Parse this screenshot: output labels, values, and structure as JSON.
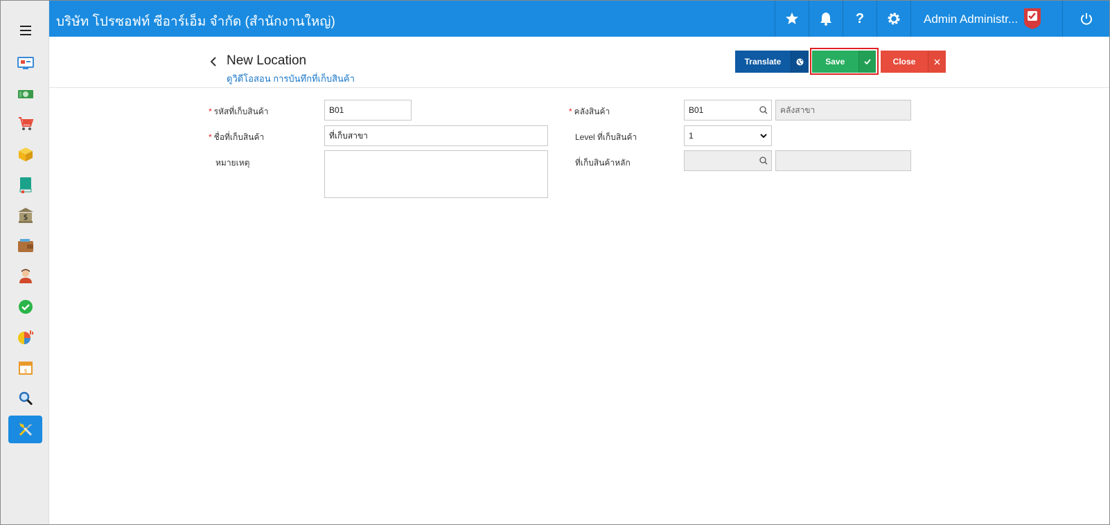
{
  "header": {
    "company": "บริษัท โปรซอฟท์ ซีอาร์เอ็ม จำกัด (สำนักงานใหญ่)",
    "user_name": "Admin Administr...",
    "icons": [
      "star-icon",
      "bell-icon",
      "help-icon",
      "settings-icon",
      "power-icon"
    ]
  },
  "sidebar": {
    "items": [
      {
        "icon": "dashboard-icon",
        "color": "#3a8bd6"
      },
      {
        "icon": "money-icon",
        "color": "#3a9a4a"
      },
      {
        "icon": "cart-icon",
        "color": "#e74c3c"
      },
      {
        "icon": "box-icon",
        "color": "#f2b418"
      },
      {
        "icon": "book-icon",
        "color": "#1aa38a"
      },
      {
        "icon": "bank-icon",
        "color": "#8a7a55"
      },
      {
        "icon": "wallet-icon",
        "color": "#b0703a"
      },
      {
        "icon": "person-icon",
        "color": "#d14a2a"
      },
      {
        "icon": "check-circle-icon",
        "color": "#2ab548"
      },
      {
        "icon": "pie-chart-icon",
        "color": "#e8583a"
      },
      {
        "icon": "calendar-icon",
        "color": "#e89a2a"
      },
      {
        "icon": "magnify-icon",
        "color": "#2a6fb8"
      },
      {
        "icon": "tools-icon",
        "color": "#f2c418"
      }
    ]
  },
  "toolbar": {
    "title": "New Location",
    "video_link": "ดูวิดีโอสอน การบันทึกที่เก็บสินค้า",
    "translate_label": "Translate",
    "save_label": "Save",
    "close_label": "Close"
  },
  "form": {
    "location_code": {
      "label": "รหัสที่เก็บสินค้า",
      "value": "B01",
      "required": true
    },
    "location_name": {
      "label": "ชื่อที่เก็บสินค้า",
      "value": "ที่เก็บสาขา",
      "required": true
    },
    "remark": {
      "label": "หมายเหตุ",
      "value": ""
    },
    "warehouse": {
      "label": "คลังสินค้า",
      "code": "B01",
      "name": "คลังสาขา",
      "required": true
    },
    "level": {
      "label": "Level ที่เก็บสินค้า",
      "value": "1"
    },
    "parent_location": {
      "label": "ที่เก็บสินค้าหลัก",
      "code": "",
      "name": ""
    }
  },
  "colors": {
    "header": "#1a8be0",
    "translate": "#0e5aa3",
    "save": "#27ae60",
    "close": "#e74c3c",
    "link": "#1976c9"
  }
}
